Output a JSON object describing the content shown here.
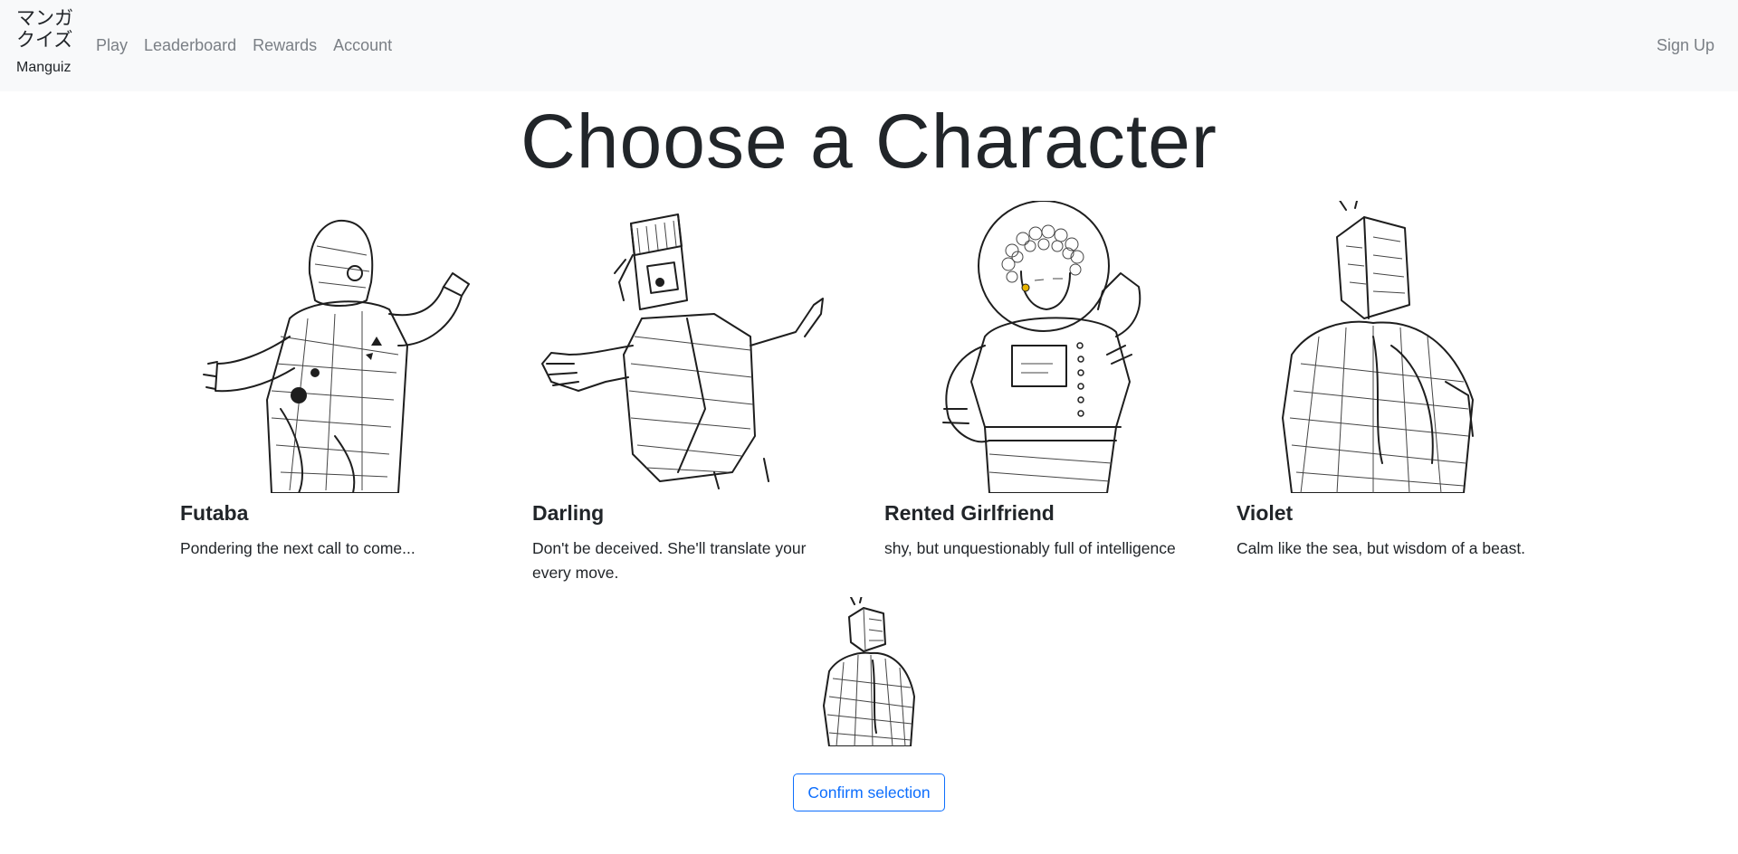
{
  "navbar": {
    "brand_jp": "マンガクイズ",
    "brand_name": "Manguiz",
    "links": [
      "Play",
      "Leaderboard",
      "Rewards",
      "Account"
    ],
    "signup": "Sign Up"
  },
  "title": "Choose a Character",
  "characters": [
    {
      "name": "Futaba",
      "description": "Pondering the next call to come..."
    },
    {
      "name": "Darling",
      "description": "Don't be deceived. She'll translate your every move."
    },
    {
      "name": "Rented Girlfriend",
      "description": "shy, but unquestionably full of intelligence"
    },
    {
      "name": "Violet",
      "description": "Calm like the sea, but wisdom of a beast."
    }
  ],
  "selected_character": "Violet",
  "confirm_label": "Confirm selection",
  "colors": {
    "navbar_bg": "#f8f9fa",
    "nav_link": "#7a7f85",
    "accent": "#0d6efd"
  },
  "icons": [
    "futaba-illustration",
    "darling-illustration",
    "rented-girlfriend-illustration",
    "violet-illustration"
  ]
}
